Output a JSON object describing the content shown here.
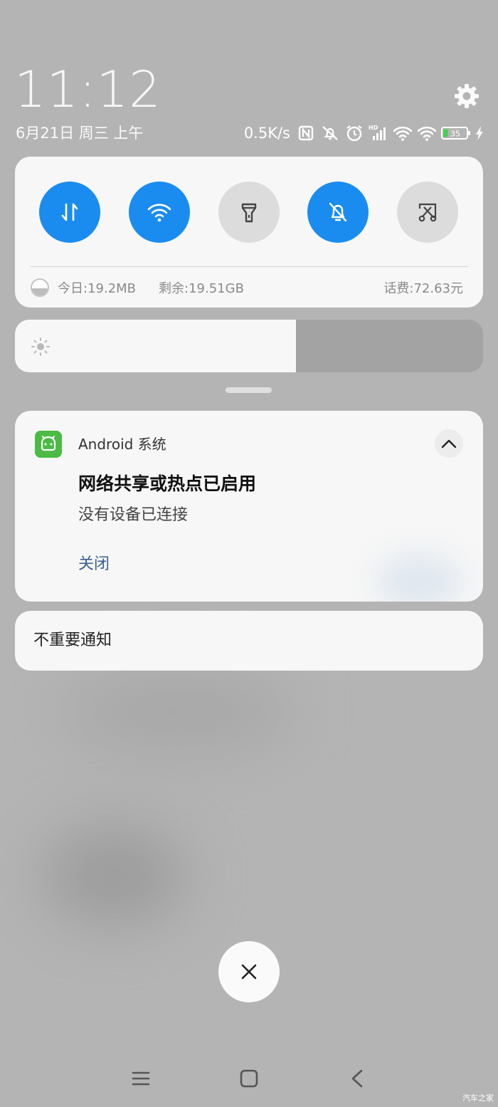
{
  "status_bar": {
    "time": "11:12",
    "date": "6月21日 周三 上午",
    "net_speed": "0.5K/s",
    "battery_level": "35",
    "icons": [
      "nfc-icon",
      "alarm-off-icon",
      "alarm-clock-icon",
      "hd-signal-icon",
      "wifi-icon",
      "hotspot-wifi-icon",
      "battery-icon",
      "charging-icon"
    ]
  },
  "quick_settings": {
    "tiles": [
      {
        "name": "mobile-data",
        "icon": "mobile-data-icon",
        "state": "on"
      },
      {
        "name": "wifi",
        "icon": "wifi-icon",
        "state": "on"
      },
      {
        "name": "flashlight",
        "icon": "flashlight-icon",
        "state": "off"
      },
      {
        "name": "mute",
        "icon": "bell-off-icon",
        "state": "on"
      },
      {
        "name": "screenshot",
        "icon": "screenshot-scissors-icon",
        "state": "off"
      }
    ],
    "data_today": "今日:19.2MB",
    "data_remaining": "剩余:19.51GB",
    "balance": "话费:72.63元",
    "accent_color": "#1a8cf0"
  },
  "brightness": {
    "level_percent": 60
  },
  "notification": {
    "app_name": "Android 系统",
    "app_icon": "android-robot-icon",
    "title": "网络共享或热点已启用",
    "text": "没有设备已连接",
    "action_label": "关闭"
  },
  "minor_notifications": {
    "label": "不重要通知"
  },
  "navigation": {
    "buttons": [
      "menu-icon",
      "home-icon",
      "back-icon"
    ]
  },
  "watermark": "汽车之家"
}
